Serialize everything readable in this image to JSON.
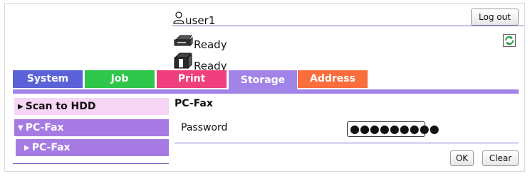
{
  "header": {
    "username": "user1",
    "logout_label": "Log out"
  },
  "status": [
    {
      "icon": "printer-icon",
      "text": "Ready"
    },
    {
      "icon": "scanner-icon",
      "text": "Ready"
    }
  ],
  "tabs": [
    {
      "label": "System",
      "color": "#5b62d8",
      "active": false
    },
    {
      "label": "Job",
      "color": "#2fc74b",
      "active": false
    },
    {
      "label": "Print",
      "color": "#ef3f7d",
      "active": false
    },
    {
      "label": "Storage",
      "color": "#a184e8",
      "active": true
    },
    {
      "label": "Address",
      "color": "#fa6d3c",
      "active": false
    }
  ],
  "sidebar": {
    "items": [
      {
        "label": "Scan to HDD",
        "arrow": "▶"
      },
      {
        "label": "PC-Fax",
        "arrow": "▼"
      },
      {
        "label": "PC-Fax",
        "arrow": "▶"
      }
    ]
  },
  "content": {
    "title": "PC-Fax",
    "password_label": "Password",
    "password_value": "●●●●●●●●●",
    "ok_label": "OK",
    "clear_label": "Clear"
  },
  "colors": {
    "accent": "#a184e8",
    "menu_active": "#a67ae3",
    "menu_inactive": "#f7d5f5",
    "divider": "#7a6cc6"
  }
}
